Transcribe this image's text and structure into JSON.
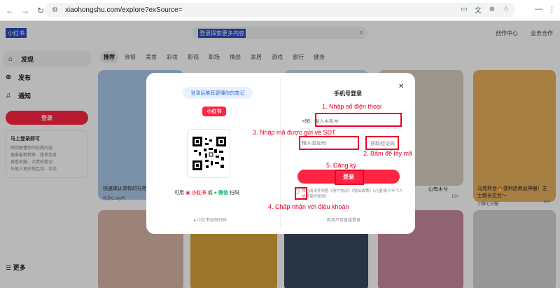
{
  "browser": {
    "url": "xiaohongshu.com/explore?exSource="
  },
  "header": {
    "logo": "小红书",
    "search_placeholder": "登录探索更多内容",
    "links": [
      "创作中心",
      "业务合作"
    ]
  },
  "sidebar": {
    "items": [
      {
        "label": "发现",
        "icon": "home-icon"
      },
      {
        "label": "发布",
        "icon": "plus-icon"
      },
      {
        "label": "通知",
        "icon": "bell-icon"
      }
    ],
    "login_button": "登录",
    "login_card_title": "马上登录即可",
    "login_card_benefits": [
      "刷到更懂你的优质内容",
      "搜索最新种草、拔草信息",
      "查看收藏、点赞的笔记",
      "与他人更好地互动、交流"
    ],
    "more": "更多"
  },
  "tabs": [
    "推荐",
    "穿搭",
    "美食",
    "彩妆",
    "影视",
    "职场",
    "情感",
    "家居",
    "游戏",
    "旅行",
    "健身"
  ],
  "feed": {
    "left_caption": "快速来认领你的礼物哦",
    "left_user": "我是Cody吗",
    "right_caption": "马克杯会🔥便利店商品神器！芝士超长拉丝～",
    "right_user": "小静七分糖",
    "likes": "10+",
    "mid_caption": "山有木兮"
  },
  "modal": {
    "promo": "登录后推荐更懂你的笔记",
    "brand": "小红书",
    "scan_prefix": "可用",
    "scan_brand": "小红书",
    "scan_or": "或",
    "scan_wechat": "微信",
    "scan_suffix": "扫码",
    "how_to_scan": "小红书如何扫码",
    "title": "手机号登录",
    "country_code": "+86",
    "phone_placeholder": "输入手机号",
    "code_placeholder": "输入验证码",
    "get_code": "获取验证码",
    "submit": "登录",
    "agreement": "我已阅读并同意《用户协议》《隐私政策》《儿童/青少年个人信息保护规则》",
    "new_user": "新用户可直接登录"
  },
  "annotations": {
    "step1": "1. Nhập số điện thoại",
    "step2": "2. Bấm để lấy mã",
    "step3": "3. Nhập mã được gửi về SĐT",
    "step4": "4. Chấp nhận với điều khoản",
    "step5": "5. Đăng ký",
    "color": "#e8002a"
  },
  "colors": {
    "brand_red": "#ff2442",
    "promo_blue": "#2d6bd8",
    "wechat_green": "#07c160"
  }
}
